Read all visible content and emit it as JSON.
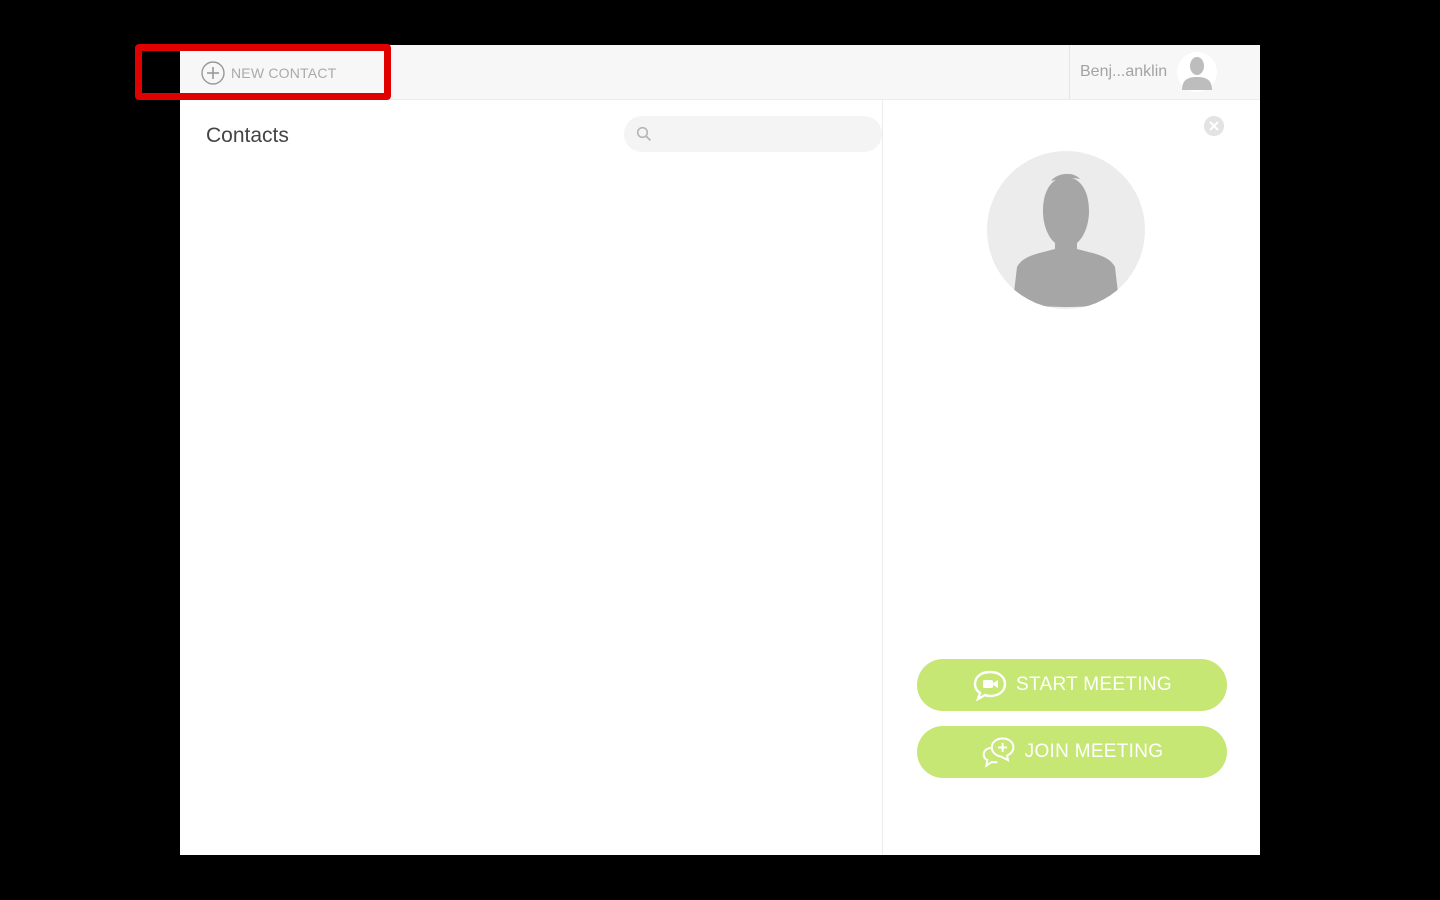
{
  "toolbar": {
    "new_contact_label": "NEW CONTACT",
    "plus_icon": "plus-circle-icon"
  },
  "user": {
    "name": "Benj...anklin",
    "avatar_icon": "user-avatar-icon"
  },
  "contacts": {
    "title": "Contacts",
    "search_placeholder": "",
    "search_icon": "search-icon",
    "items": []
  },
  "detail": {
    "close_icon": "close-circle-icon",
    "avatar_icon": "user-silhouette-icon",
    "start_meeting_label": "START MEETING",
    "join_meeting_label": "JOIN MEETING",
    "start_icon": "video-chat-icon",
    "join_icon": "chat-plus-icon"
  },
  "colors": {
    "accent_green": "#c6e773",
    "highlight_red": "#e00000",
    "background": "#000000"
  }
}
